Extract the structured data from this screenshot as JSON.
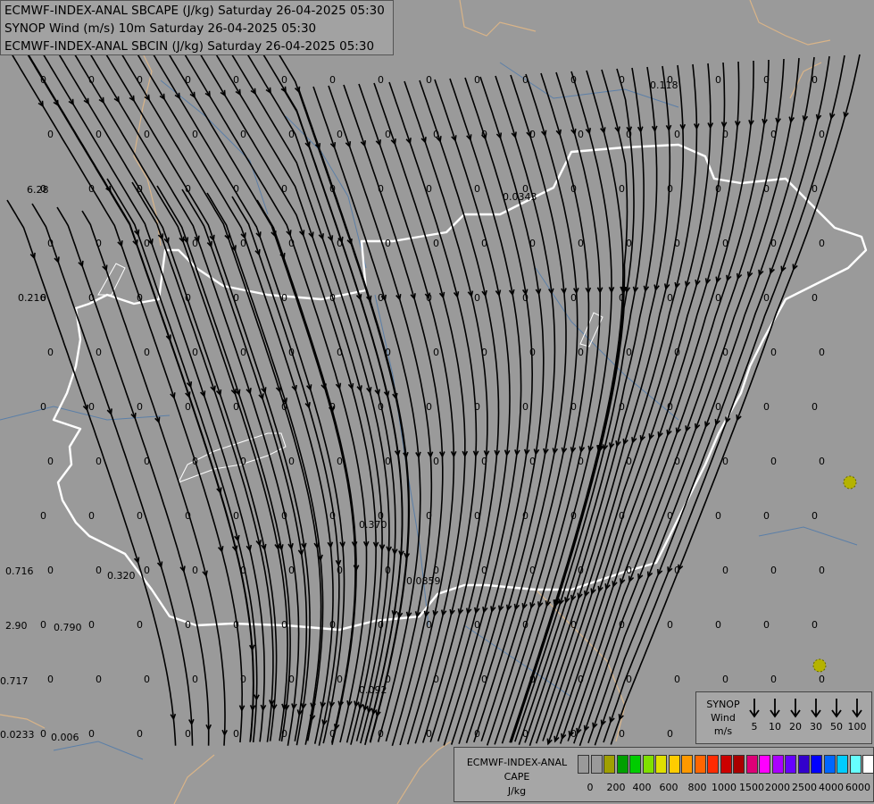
{
  "header": {
    "line1": "ECMWF-INDEX-ANAL SBCAPE (J/kg) Saturday 26-04-2025 05:30",
    "line2": "SYNOP Wind (m/s) 10m Saturday 26-04-2025 05:30",
    "line3": "ECMWF-INDEX-ANAL SBCIN (J/kg) Saturday 26-04-2025 05:30"
  },
  "colors": {
    "background": "#9a9a9a",
    "border": "#ffffff",
    "terrain_line": "#d9b488",
    "river": "#5b7fa8",
    "streamline": "#000000"
  },
  "synop_legend": {
    "title": [
      "SYNOP",
      "Wind",
      "m/s"
    ],
    "speeds": [
      "5",
      "10",
      "20",
      "30",
      "50",
      "100"
    ]
  },
  "cape_legend": {
    "title": [
      "ECMWF-INDEX-ANAL",
      "CAPE",
      "J/kg"
    ],
    "colors": [
      "#9a9a9a",
      "#9a9a9a",
      "#a0a000",
      "#00a000",
      "#00cc00",
      "#7fe000",
      "#e0e000",
      "#ffcc00",
      "#ff9900",
      "#ff6600",
      "#ff2a00",
      "#cc0000",
      "#aa0000",
      "#dd0077",
      "#ff00ff",
      "#aa00ff",
      "#6600ff",
      "#3300cc",
      "#0000ff",
      "#0066ff",
      "#00ccff",
      "#66ffff",
      "#ffffff"
    ],
    "ticks": [
      "0",
      "200",
      "400",
      "600",
      "800",
      "1000",
      "1500",
      "2000",
      "2500",
      "4000",
      "6000"
    ]
  },
  "grid_values": [
    [
      "0",
      "0",
      "0",
      "0",
      "0",
      "0",
      "0",
      "0",
      "0",
      "0",
      "0",
      "0",
      "0",
      "0",
      "0",
      "0",
      "0",
      "0"
    ],
    [
      "6.28",
      "0.216",
      "0.716",
      "0.320",
      "0.790",
      "0.717",
      "0.0233",
      "0.006",
      "0.370",
      "0.0859",
      "0.092",
      "0.0343",
      "0.118",
      "2.90"
    ]
  ]
}
